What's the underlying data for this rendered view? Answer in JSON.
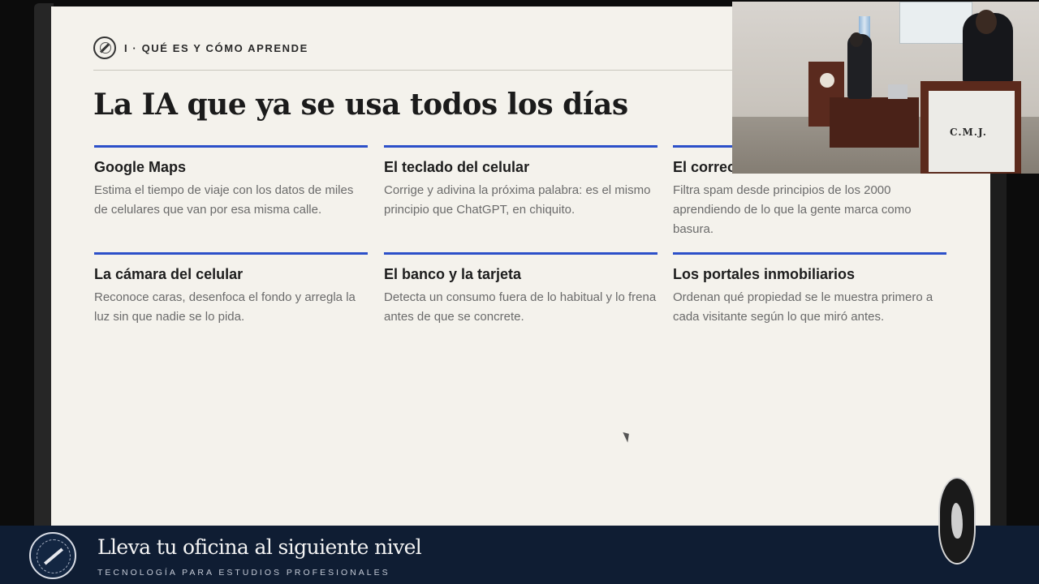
{
  "slide": {
    "section_label": "I · QUÉ ES Y CÓMO APRENDE",
    "title": "La IA que ya se usa todos los días",
    "cards": [
      {
        "title": "Google Maps",
        "desc": "Estima el tiempo de viaje con los datos de miles de celulares que van por esa misma calle."
      },
      {
        "title": "El teclado del celular",
        "desc": "Corrige y adivina la próxima palabra: es el mismo principio que ChatGPT, en chiquito."
      },
      {
        "title": "El correo",
        "desc": "Filtra spam desde principios de los 2000 aprendiendo de lo que la gente marca como basura."
      },
      {
        "title": "La cámara del celular",
        "desc": "Reconoce caras, desenfoca el fondo y arregla la luz sin que nadie se lo pida."
      },
      {
        "title": "El banco y la tarjeta",
        "desc": "Detecta un consumo fuera de lo habitual y lo frena antes de que se concrete."
      },
      {
        "title": "Los portales inmobiliarios",
        "desc": "Ordenan qué propiedad se le muestra primero a cada visitante según lo que miró antes."
      }
    ],
    "accent_color": "#2c50c9"
  },
  "camera": {
    "podium_sign": "C.M.J."
  },
  "lower_third": {
    "title": "Lleva tu oficina al siguiente nivel",
    "subtitle": "TECNOLOGÍA PARA ESTUDIOS PROFESIONALES",
    "logo_icon": "gavel-seal-icon"
  }
}
